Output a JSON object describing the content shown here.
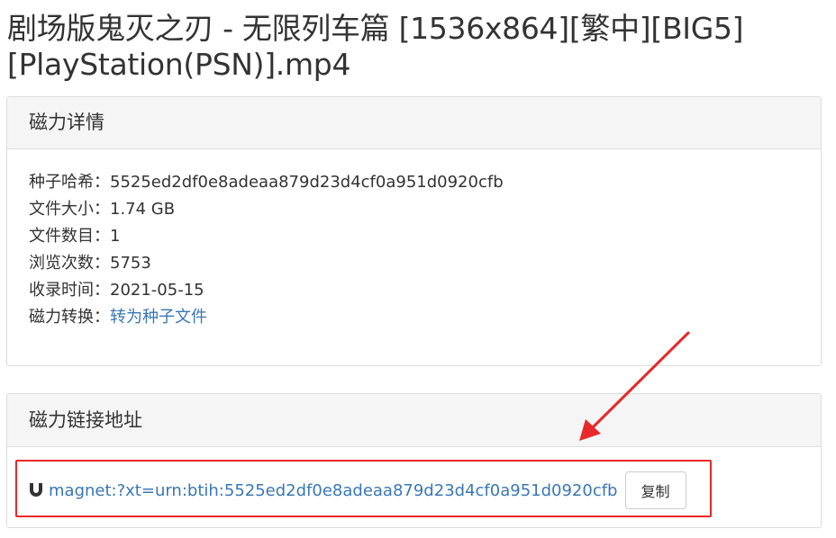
{
  "title": "剧场版鬼灭之刃 - 无限列车篇 [1536x864][繁中][BIG5][PlayStation(PSN)].mp4",
  "details_panel": {
    "heading": "磁力详情",
    "rows": [
      {
        "label": "种子哈希：",
        "value": "5525ed2df0e8adeaa879d23d4cf0a951d0920cfb"
      },
      {
        "label": "文件大小：",
        "value": "1.74 GB"
      },
      {
        "label": "文件数目：",
        "value": "1"
      },
      {
        "label": "浏览次数：",
        "value": "5753"
      },
      {
        "label": "收录时间：",
        "value": "2021-05-15"
      },
      {
        "label": "磁力转换：",
        "link": "转为种子文件"
      }
    ]
  },
  "magnet_panel": {
    "heading": "磁力链接地址",
    "icon": "magnet-icon",
    "link": "magnet:?xt=urn:btih:5525ed2df0e8adeaa879d23d4cf0a951d0920cfb",
    "copy_label": "复制"
  },
  "colors": {
    "link": "#3a77b4",
    "highlight": "#e8282a",
    "panel_heading_bg": "#f5f5f5",
    "border": "#dddddd"
  }
}
